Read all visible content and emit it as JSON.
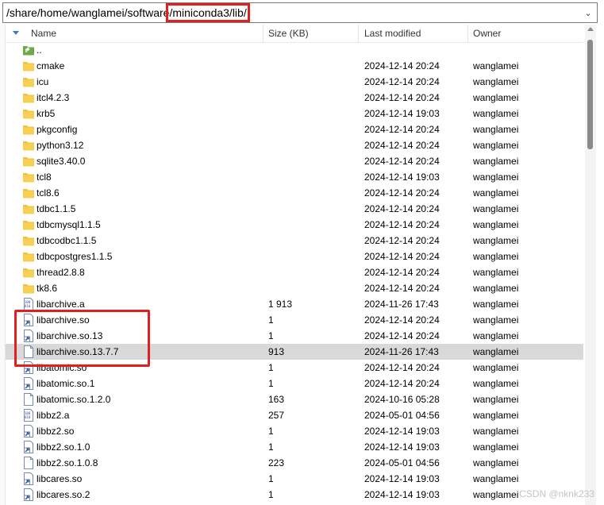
{
  "path_bar": {
    "prefix": "/share/home/wanglamei/software",
    "highlight": "/miniconda3/lib/",
    "dropdown_icon": "chevron-down-icon"
  },
  "columns": {
    "name": "Name",
    "size": "Size (KB)",
    "modified": "Last modified",
    "owner": "Owner"
  },
  "rows": [
    {
      "type": "parent",
      "name": "..",
      "size": "",
      "modified": "",
      "owner": ""
    },
    {
      "type": "folder",
      "name": "cmake",
      "size": "",
      "modified": "2024-12-14 20:24",
      "owner": "wanglamei"
    },
    {
      "type": "folder",
      "name": "icu",
      "size": "",
      "modified": "2024-12-14 20:24",
      "owner": "wanglamei"
    },
    {
      "type": "folder",
      "name": "itcl4.2.3",
      "size": "",
      "modified": "2024-12-14 20:24",
      "owner": "wanglamei"
    },
    {
      "type": "folder",
      "name": "krb5",
      "size": "",
      "modified": "2024-12-14 19:03",
      "owner": "wanglamei"
    },
    {
      "type": "folder",
      "name": "pkgconfig",
      "size": "",
      "modified": "2024-12-14 20:24",
      "owner": "wanglamei"
    },
    {
      "type": "folder",
      "name": "python3.12",
      "size": "",
      "modified": "2024-12-14 20:24",
      "owner": "wanglamei"
    },
    {
      "type": "folder",
      "name": "sqlite3.40.0",
      "size": "",
      "modified": "2024-12-14 20:24",
      "owner": "wanglamei"
    },
    {
      "type": "folder",
      "name": "tcl8",
      "size": "",
      "modified": "2024-12-14 19:03",
      "owner": "wanglamei"
    },
    {
      "type": "folder",
      "name": "tcl8.6",
      "size": "",
      "modified": "2024-12-14 20:24",
      "owner": "wanglamei"
    },
    {
      "type": "folder",
      "name": "tdbc1.1.5",
      "size": "",
      "modified": "2024-12-14 20:24",
      "owner": "wanglamei"
    },
    {
      "type": "folder",
      "name": "tdbcmysql1.1.5",
      "size": "",
      "modified": "2024-12-14 20:24",
      "owner": "wanglamei"
    },
    {
      "type": "folder",
      "name": "tdbcodbc1.1.5",
      "size": "",
      "modified": "2024-12-14 20:24",
      "owner": "wanglamei"
    },
    {
      "type": "folder",
      "name": "tdbcpostgres1.1.5",
      "size": "",
      "modified": "2024-12-14 20:24",
      "owner": "wanglamei"
    },
    {
      "type": "folder",
      "name": "thread2.8.8",
      "size": "",
      "modified": "2024-12-14 20:24",
      "owner": "wanglamei"
    },
    {
      "type": "folder",
      "name": "tk8.6",
      "size": "",
      "modified": "2024-12-14 20:24",
      "owner": "wanglamei"
    },
    {
      "type": "archive",
      "name": "libarchive.a",
      "size": "1 913",
      "modified": "2024-11-26 17:43",
      "owner": "wanglamei"
    },
    {
      "type": "link",
      "name": "libarchive.so",
      "size": "1",
      "modified": "2024-12-14 20:24",
      "owner": "wanglamei"
    },
    {
      "type": "link",
      "name": "libarchive.so.13",
      "size": "1",
      "modified": "2024-12-14 20:24",
      "owner": "wanglamei"
    },
    {
      "type": "file",
      "name": "libarchive.so.13.7.7",
      "size": "913",
      "modified": "2024-11-26 17:43",
      "owner": "wanglamei",
      "selected": true
    },
    {
      "type": "link",
      "name": "libatomic.so",
      "size": "1",
      "modified": "2024-12-14 20:24",
      "owner": "wanglamei"
    },
    {
      "type": "link",
      "name": "libatomic.so.1",
      "size": "1",
      "modified": "2024-12-14 20:24",
      "owner": "wanglamei"
    },
    {
      "type": "file",
      "name": "libatomic.so.1.2.0",
      "size": "163",
      "modified": "2024-10-16 05:28",
      "owner": "wanglamei"
    },
    {
      "type": "archive",
      "name": "libbz2.a",
      "size": "257",
      "modified": "2024-05-01 04:56",
      "owner": "wanglamei"
    },
    {
      "type": "link",
      "name": "libbz2.so",
      "size": "1",
      "modified": "2024-12-14 19:03",
      "owner": "wanglamei"
    },
    {
      "type": "link",
      "name": "libbz2.so.1.0",
      "size": "1",
      "modified": "2024-12-14 19:03",
      "owner": "wanglamei"
    },
    {
      "type": "file",
      "name": "libbz2.so.1.0.8",
      "size": "223",
      "modified": "2024-05-01 04:56",
      "owner": "wanglamei"
    },
    {
      "type": "link",
      "name": "libcares.so",
      "size": "1",
      "modified": "2024-12-14 19:03",
      "owner": "wanglamei"
    },
    {
      "type": "link",
      "name": "libcares.so.2",
      "size": "1",
      "modified": "2024-12-14 19:03",
      "owner": "wanglamei"
    }
  ],
  "watermark": "CSDN @nknk233",
  "colors": {
    "annotation": "#e02020",
    "folder": "#f2c23c",
    "selection": "#d9d9d9"
  }
}
